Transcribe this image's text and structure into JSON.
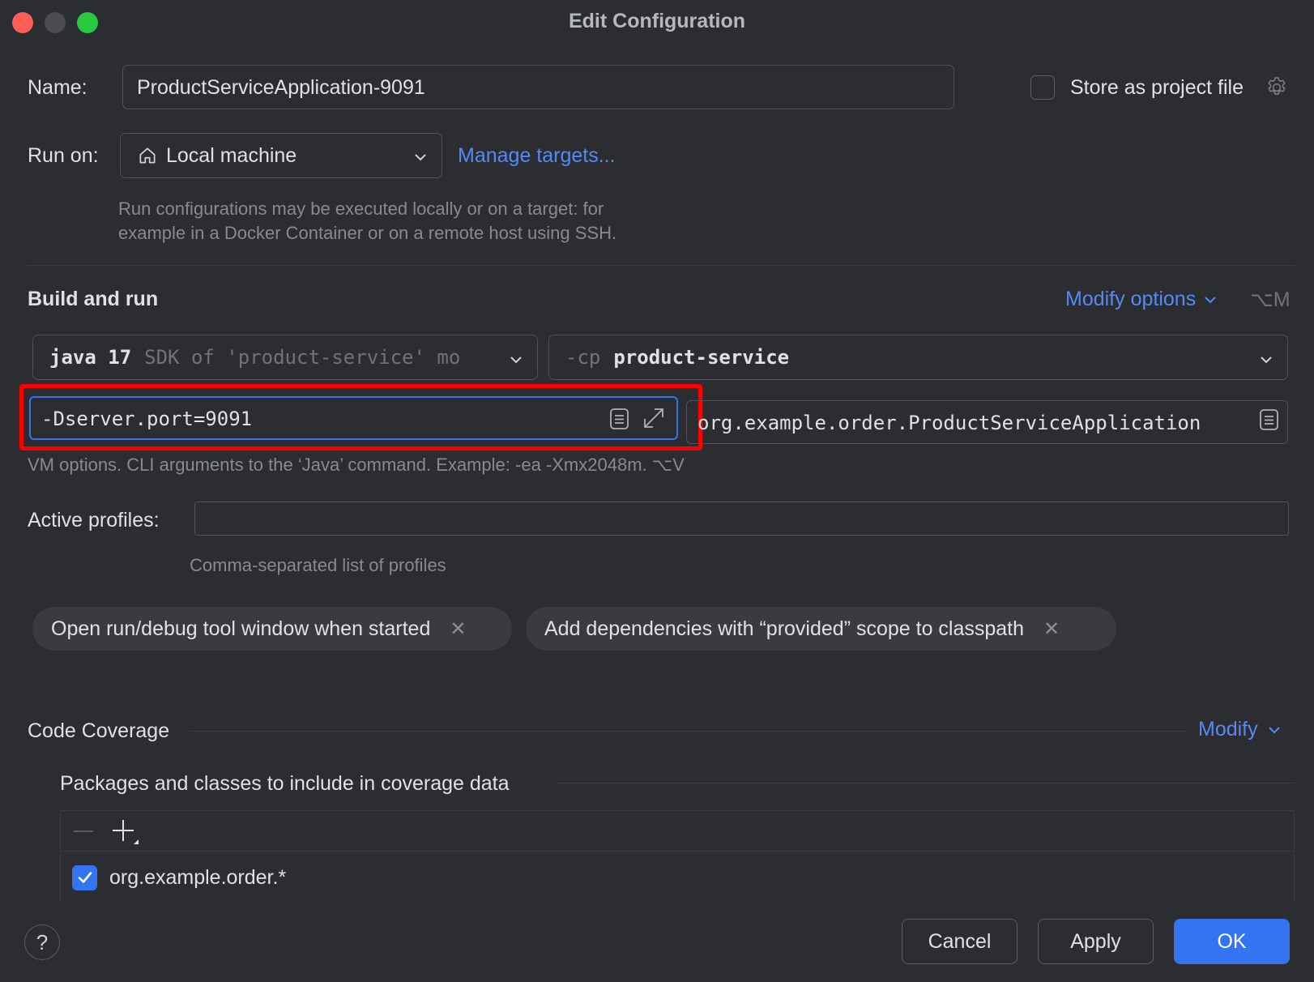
{
  "window": {
    "title": "Edit Configuration"
  },
  "name": {
    "label": "Name:",
    "value": "ProductServiceApplication-9091"
  },
  "store": {
    "label": "Store as project file"
  },
  "run_on": {
    "label": "Run on:",
    "value": "Local machine",
    "manage_link": "Manage targets...",
    "help_line1": "Run configurations may be executed locally or on a target: for",
    "help_line2": "example in a Docker Container or on a remote host using SSH."
  },
  "build_run": {
    "heading": "Build and run",
    "modify_options": "Modify options",
    "shortcut": "⌥M",
    "jdk_main": "java 17",
    "jdk_hint": "SDK of 'product-service' mo",
    "cp_prefix": "-cp",
    "cp_value": "product-service",
    "vm_options": "-Dserver.port=9091",
    "main_class": "org.example.order.ProductServiceApplication",
    "vm_help": "VM options. CLI arguments to the ‘Java’ command. Example: -ea -Xmx2048m. ⌥V"
  },
  "profiles": {
    "label": "Active profiles:",
    "value": "",
    "help": "Comma-separated list of profiles"
  },
  "chips": [
    {
      "label": "Open run/debug tool window when started"
    },
    {
      "label": "Add dependencies with “provided” scope to classpath"
    }
  ],
  "coverage": {
    "heading": "Code Coverage",
    "modify": "Modify",
    "packages_heading": "Packages and classes to include in coverage data",
    "items": [
      {
        "label": "org.example.order.*",
        "checked": true
      }
    ]
  },
  "footer": {
    "help": "?",
    "cancel": "Cancel",
    "apply": "Apply",
    "ok": "OK"
  },
  "colors": {
    "background": "#2b2d30",
    "accent": "#3574f0",
    "link": "#548af7",
    "highlight": "#ff0000"
  }
}
